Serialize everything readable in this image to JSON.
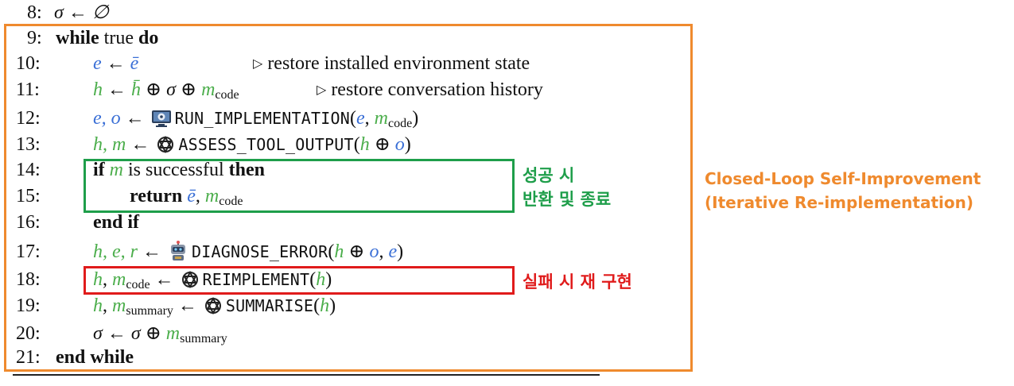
{
  "algorithm": {
    "lines": [
      {
        "num": "8:",
        "text": "σ ← ∅"
      },
      {
        "num": "9:",
        "kw_while": "while",
        "mid": "true",
        "kw_do": "do"
      },
      {
        "num": "10:",
        "e": "e",
        "arrow": "←",
        "ebar": "ē",
        "comment": "restore installed environment state"
      },
      {
        "num": "11:",
        "h": "h",
        "arrow": "←",
        "hbar": "h̄",
        "op1": "⊕",
        "sigma": "σ",
        "op2": "⊕",
        "m": "m",
        "sub": "code",
        "comment": "restore conversation history"
      },
      {
        "num": "12:",
        "lhs": "e, o",
        "arrow": "←",
        "func": "RUN_IMPLEMENTATION",
        "args_a": "e",
        "args_sep": ",",
        "args_m": "m",
        "args_sub": "code"
      },
      {
        "num": "13:",
        "lhs": "h, m",
        "arrow": "←",
        "func": "ASSESS_TOOL_OUTPUT",
        "arg_h": "h",
        "arg_op": "⊕",
        "arg_o": "o"
      },
      {
        "num": "14:",
        "kw_if": "if",
        "m": "m",
        "mid": "is successful",
        "kw_then": "then"
      },
      {
        "num": "15:",
        "kw_return": "return",
        "ebar": "ē",
        "sep": ",",
        "m": "m",
        "sub": "code"
      },
      {
        "num": "16:",
        "kw": "end if"
      },
      {
        "num": "17:",
        "lhs": "h, e, r",
        "arrow": "←",
        "func": "DIAGNOSE_ERROR",
        "arg_h": "h",
        "arg_op": "⊕",
        "arg_o": "o",
        "arg_sep": ",",
        "arg_e": "e"
      },
      {
        "num": "18:",
        "lhs_h": "h",
        "lhs_sep": ",",
        "lhs_m": "m",
        "lhs_sub": "code",
        "arrow": "←",
        "func": "REIMPLEMENT",
        "arg_h": "h"
      },
      {
        "num": "19:",
        "lhs_h": "h",
        "lhs_sep": ",",
        "lhs_m": "m",
        "lhs_sub": "summary",
        "arrow": "←",
        "func": "SUMMARISE",
        "arg_h": "h"
      },
      {
        "num": "20:",
        "sigma": "σ",
        "arrow": "←",
        "sigma2": "σ",
        "op": "⊕",
        "m": "m",
        "sub": "summary"
      },
      {
        "num": "21:",
        "kw": "end while"
      }
    ],
    "paren_open": "(",
    "paren_close": ")",
    "comment_marker": "▷"
  },
  "annotations": {
    "success_line1": "성공 시",
    "success_line2": "반환 및 종료",
    "failure": "실패 시 재 구현",
    "loop_title_line1": "Closed-Loop Self-Improvement",
    "loop_title_line2": "(Iterative Re-implementation)"
  },
  "colors": {
    "loop_box": "#ef8a2e",
    "success_box": "#1e9e4a",
    "failure_box": "#e01b1b",
    "var_blue": "#3a6fd6",
    "var_green": "#4cae4c"
  },
  "icons": {
    "run": "monitor-gear-icon",
    "llm": "openai-knot-icon",
    "diagnose": "robot-icon"
  }
}
